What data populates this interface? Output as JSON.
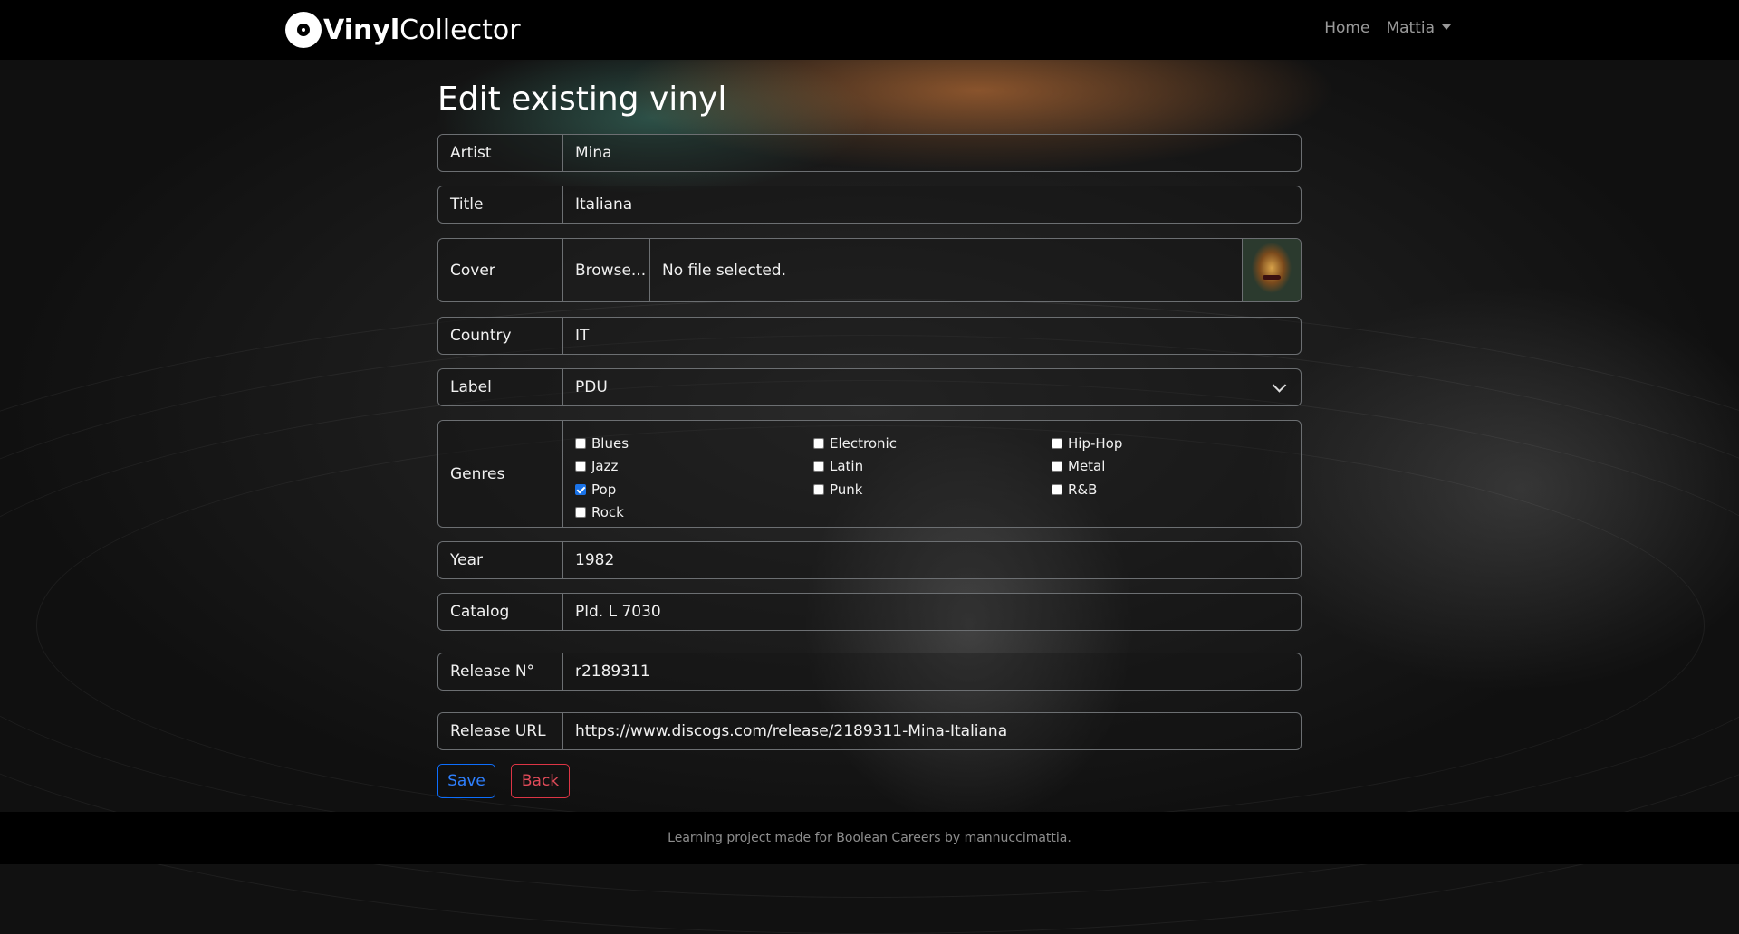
{
  "navbar": {
    "brand_bold": "Vinyl",
    "brand_light": "Collector",
    "home_label": "Home",
    "user_label": "Mattia"
  },
  "page": {
    "title": "Edit existing vinyl"
  },
  "form": {
    "artist": {
      "label": "Artist",
      "value": "Mina"
    },
    "title": {
      "label": "Title",
      "value": "Italiana"
    },
    "cover": {
      "label": "Cover",
      "browse_label": "Browse...",
      "file_status": "No file selected."
    },
    "country": {
      "label": "Country",
      "value": "IT"
    },
    "record_label": {
      "label": "Label",
      "selected": "PDU"
    },
    "genres": {
      "label": "Genres",
      "options": [
        {
          "name": "Blues",
          "checked": false
        },
        {
          "name": "Electronic",
          "checked": false
        },
        {
          "name": "Hip-Hop",
          "checked": false
        },
        {
          "name": "Jazz",
          "checked": false
        },
        {
          "name": "Latin",
          "checked": false
        },
        {
          "name": "Metal",
          "checked": false
        },
        {
          "name": "Pop",
          "checked": true
        },
        {
          "name": "Punk",
          "checked": false
        },
        {
          "name": "R&B",
          "checked": false
        },
        {
          "name": "Rock",
          "checked": false
        }
      ]
    },
    "year": {
      "label": "Year",
      "value": "1982"
    },
    "catalog": {
      "label": "Catalog",
      "value": "Pld. L 7030"
    },
    "release_no": {
      "label": "Release N°",
      "value": "r2189311"
    },
    "release_url": {
      "label": "Release URL",
      "value": "https://www.discogs.com/release/2189311-Mina-Italiana"
    },
    "save_label": "Save",
    "back_label": "Back"
  },
  "colors": {
    "primary": "#0d6efd",
    "danger": "#dc3545",
    "checkbox_checked": "#1a73e8"
  },
  "footer": {
    "text": "Learning project made for Boolean Careers by mannuccimattia."
  }
}
